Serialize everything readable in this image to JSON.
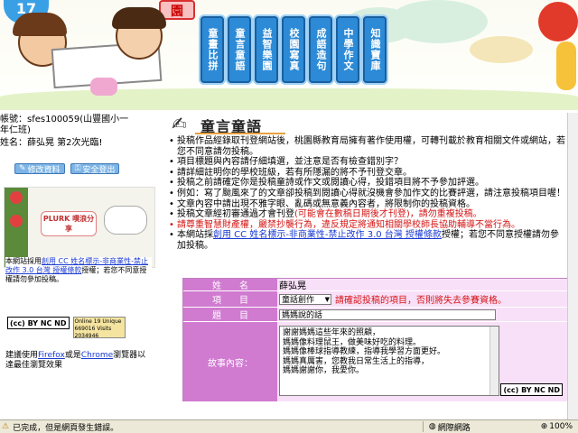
{
  "nav": [
    {
      "label": "童畫比拼"
    },
    {
      "label": "童言童語"
    },
    {
      "label": "益智樂園"
    },
    {
      "label": "校園寫真"
    },
    {
      "label": "成語造句"
    },
    {
      "label": "中學作文"
    },
    {
      "label": "知識寶庫"
    }
  ],
  "user": {
    "account_line": "帳號：sfes100059(山豐國小一年仁班)",
    "name_line": "姓名：薛弘晃 第2次光臨!",
    "edit_btn": "修改資料",
    "logout_btn": "安全登出"
  },
  "left": {
    "plurk_label": "PLURK 噗浪分享",
    "license_pre": "本網站採用",
    "license_link": "創用 CC 姓名標示-非商業性-禁止改作 3.0 台灣 授權條款",
    "license_post": "授權；若您不同意授權請勿參加投稿。",
    "browser_pre": "建議使用",
    "browser_ff": "Firefox",
    "browser_mid": "或是",
    "browser_chrome": "Chrome",
    "browser_post": "瀏覽器以達最佳瀏覽效果",
    "counter_label": "Online 19 Unique 669016 Visits 2034946"
  },
  "section_title": "童言童語",
  "bullets": {
    "b1": "投稿作品經錄取刊登網站後，桃園縣教育局擁有著作使用權，可轉刊載於教育相關文件或網站，若您不同意請勿投稿。",
    "b2": "項目標題與內容請仔細填選，並注意是否有檢查錯別字？",
    "b3": "請詳細註明你的學校班級，若有所隱漏的將不予刊登交章。",
    "b4": "投稿之前請確定你是投稿童詩或作文或閱讀心得，投錯項目將不予參加評選。",
    "b5": "例如：寫了颱風來了的文章卻投稿到閱讀心得就沒機會參加作文的比賽評選，請注意投稿項目喔！",
    "b6": "文章內容中請出現不雅字眼、亂碼或無意義內容者，將限制你的投稿資格。",
    "b7_pre": "投稿文章經初審通過才會刊登",
    "b7_red": "(可能會在數稿日期後才刊登)，請勿重複投稿。",
    "b8": "請尊重智慧財產權，嚴禁抄襲行為，違反規定將通知相關學校師長協助輔導不當行為。",
    "b9_pre": "本網站採",
    "b9_link": "創用 CC 姓名標示-非商業性-禁止改作 3.0 台灣 授權條款",
    "b9_post": "授權；若您不同意授權請勿參加投稿。"
  },
  "form": {
    "name_label": "姓　　名",
    "name_value": "薛弘晃",
    "item_label": "項　　目",
    "item_select": "童話創作",
    "item_warning": "請確認投稿的項目，否則將失去參賽資格。",
    "title_label": "題　　目",
    "title_value": "媽媽說的話",
    "content_label": "故事內容：",
    "content_lines": [
      "謝謝媽媽這些年來的照顧，",
      "媽媽像料理鼠王，做美味好吃的料理。",
      "媽媽像棒球指導教練，指導我學習方面更好。",
      "媽媽真厲害，您教我日常生活上的指導，",
      "媽媽謝謝你，我愛你。"
    ]
  },
  "status": {
    "left": "已完成，但是網頁發生錯誤。",
    "zone": "網際網路",
    "zoom": "100%"
  }
}
